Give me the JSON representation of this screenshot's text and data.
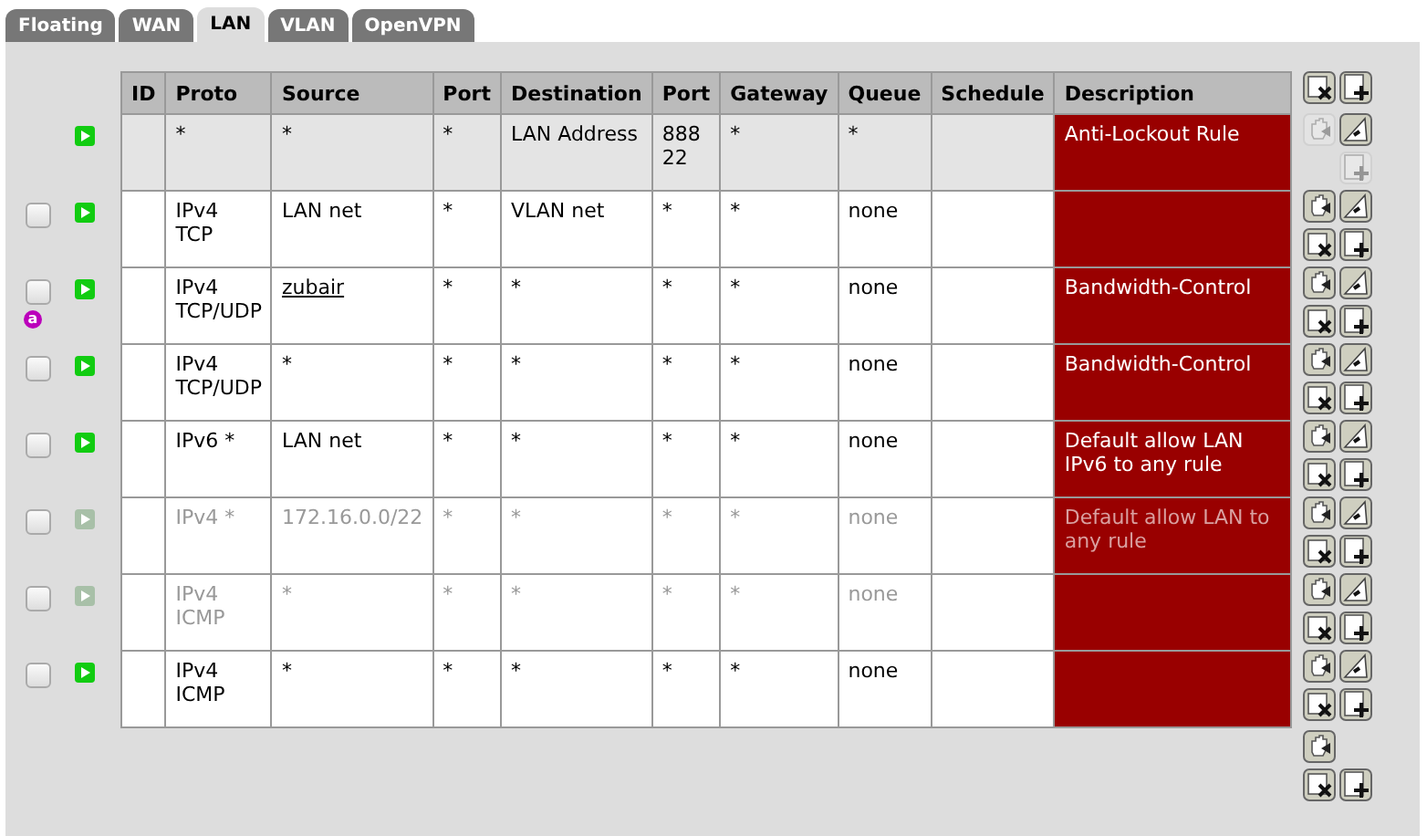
{
  "tabs": [
    {
      "label": "Floating",
      "selected": false
    },
    {
      "label": "WAN",
      "selected": false
    },
    {
      "label": "LAN",
      "selected": true
    },
    {
      "label": "VLAN",
      "selected": false
    },
    {
      "label": "OpenVPN",
      "selected": false
    }
  ],
  "table": {
    "columns": [
      "ID",
      "Proto",
      "Source",
      "Port",
      "Destination",
      "Port",
      "Gateway",
      "Queue",
      "Schedule",
      "Description"
    ],
    "header_actions": [
      {
        "kind": "delete",
        "disabled": false
      },
      {
        "kind": "add",
        "disabled": false
      }
    ],
    "rows": [
      {
        "kind": "fixed",
        "enabled": true,
        "cells": [
          "",
          "*",
          "*",
          "*",
          "LAN Address",
          "888\n22",
          "*",
          "*",
          "",
          "Anti-Lockout Rule"
        ],
        "actions": [
          {
            "kind": "move",
            "disabled": true
          },
          {
            "kind": "edit",
            "disabled": false
          },
          {
            "kind": "spacer"
          },
          {
            "kind": "add",
            "disabled": true
          }
        ]
      },
      {
        "kind": "rule",
        "enabled": true,
        "checked": false,
        "cells": [
          "",
          "IPv4\nTCP",
          "LAN net",
          "*",
          "VLAN net",
          "*",
          "*",
          "none",
          "",
          ""
        ],
        "actions": [
          {
            "kind": "move",
            "disabled": false
          },
          {
            "kind": "edit",
            "disabled": false
          },
          {
            "kind": "delete",
            "disabled": false
          },
          {
            "kind": "add",
            "disabled": false
          }
        ]
      },
      {
        "kind": "rule",
        "enabled": true,
        "checked": false,
        "badge": "a",
        "source_link": true,
        "cells": [
          "",
          "IPv4\nTCP/UDP",
          "zubair",
          "*",
          "*",
          "*",
          "*",
          "none",
          "",
          "Bandwidth-Control"
        ],
        "actions": [
          {
            "kind": "move",
            "disabled": false
          },
          {
            "kind": "edit",
            "disabled": false
          },
          {
            "kind": "delete",
            "disabled": false
          },
          {
            "kind": "add",
            "disabled": false
          }
        ]
      },
      {
        "kind": "rule",
        "enabled": true,
        "checked": false,
        "cells": [
          "",
          "IPv4\nTCP/UDP",
          "*",
          "*",
          "*",
          "*",
          "*",
          "none",
          "",
          "Bandwidth-Control"
        ],
        "actions": [
          {
            "kind": "move",
            "disabled": false
          },
          {
            "kind": "edit",
            "disabled": false
          },
          {
            "kind": "delete",
            "disabled": false
          },
          {
            "kind": "add",
            "disabled": false
          }
        ]
      },
      {
        "kind": "rule",
        "enabled": true,
        "checked": false,
        "cells": [
          "",
          "IPv6 *",
          "LAN net",
          "*",
          "*",
          "*",
          "*",
          "none",
          "",
          "Default allow LAN IPv6 to any rule"
        ],
        "actions": [
          {
            "kind": "move",
            "disabled": false
          },
          {
            "kind": "edit",
            "disabled": false
          },
          {
            "kind": "delete",
            "disabled": false
          },
          {
            "kind": "add",
            "disabled": false
          }
        ]
      },
      {
        "kind": "rule",
        "enabled": false,
        "checked": false,
        "cells": [
          "",
          "IPv4 *",
          "172.16.0.0/22",
          "*",
          "*",
          "*",
          "*",
          "none",
          "",
          "Default allow LAN to any rule"
        ],
        "actions": [
          {
            "kind": "move",
            "disabled": false
          },
          {
            "kind": "edit",
            "disabled": false
          },
          {
            "kind": "delete",
            "disabled": false
          },
          {
            "kind": "add",
            "disabled": false
          }
        ]
      },
      {
        "kind": "rule",
        "enabled": false,
        "checked": false,
        "cells": [
          "",
          "IPv4\nICMP",
          "*",
          "*",
          "*",
          "*",
          "*",
          "none",
          "",
          ""
        ],
        "actions": [
          {
            "kind": "move",
            "disabled": false
          },
          {
            "kind": "edit",
            "disabled": false
          },
          {
            "kind": "delete",
            "disabled": false
          },
          {
            "kind": "add",
            "disabled": false
          }
        ]
      },
      {
        "kind": "rule",
        "enabled": true,
        "checked": false,
        "cells": [
          "",
          "IPv4\nICMP",
          "*",
          "*",
          "*",
          "*",
          "*",
          "none",
          "",
          ""
        ],
        "actions": [
          {
            "kind": "move",
            "disabled": false
          },
          {
            "kind": "edit",
            "disabled": false
          },
          {
            "kind": "delete",
            "disabled": false
          },
          {
            "kind": "add",
            "disabled": false
          }
        ]
      }
    ],
    "footer_actions": [
      {
        "kind": "move",
        "disabled": false
      },
      {
        "kind": "spacer"
      },
      {
        "kind": "delete",
        "disabled": false
      },
      {
        "kind": "add",
        "disabled": false
      }
    ]
  }
}
